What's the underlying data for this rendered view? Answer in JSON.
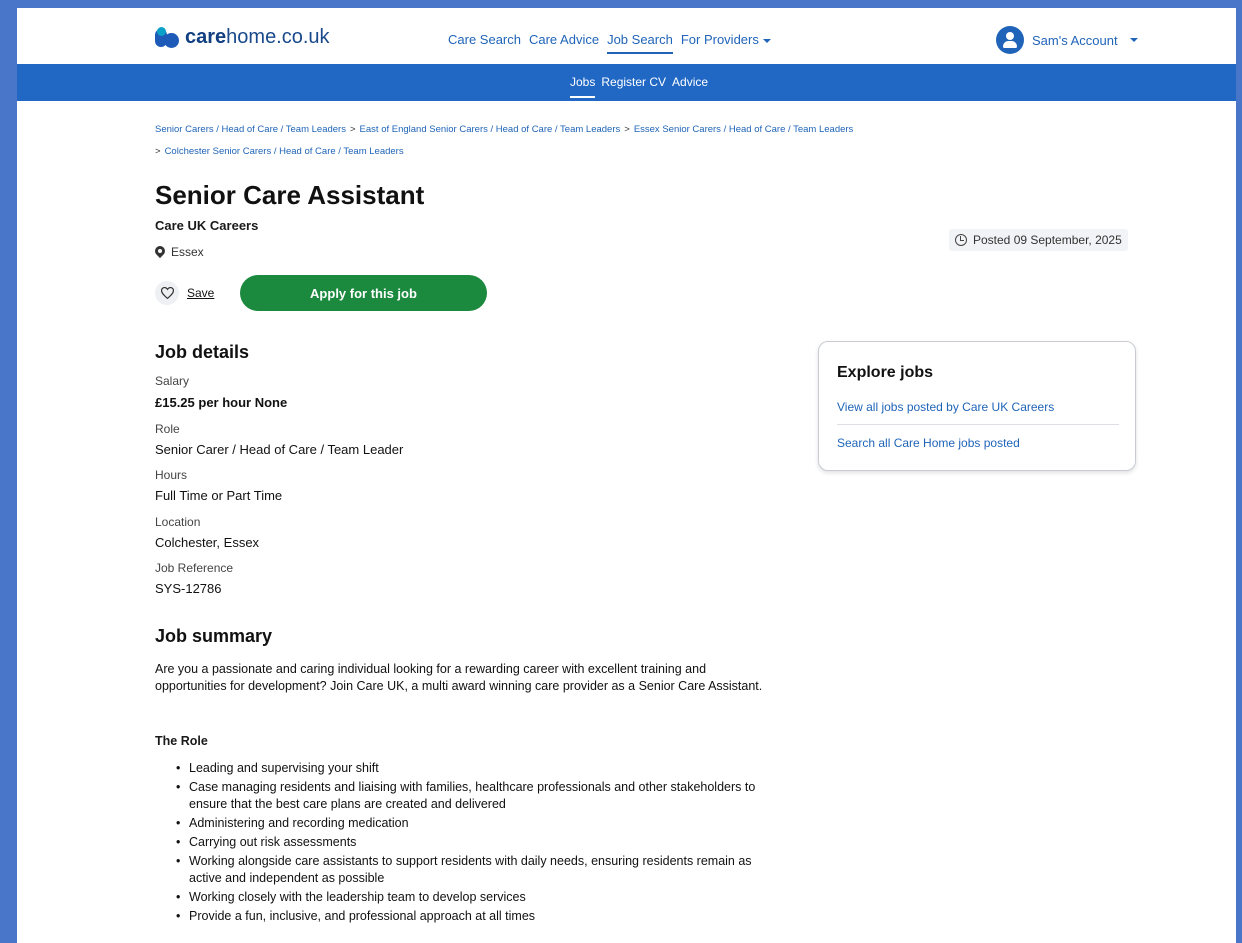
{
  "nav": {
    "logo_care": "care",
    "logo_rest": "home.co.uk",
    "links": [
      {
        "label": "Care Search"
      },
      {
        "label": "Care Advice"
      },
      {
        "label": "Job Search"
      },
      {
        "label": "For Providers"
      }
    ],
    "account_label": "Sam's Account"
  },
  "subnav": {
    "links": [
      {
        "label": "Jobs"
      },
      {
        "label": "Register CV"
      },
      {
        "label": "Advice"
      }
    ]
  },
  "breadcrumb": [
    "Senior Carers / Head of Care / Team Leaders",
    "East of England Senior Carers / Head of Care / Team Leaders",
    "Essex Senior Carers / Head of Care / Team Leaders",
    "Colchester Senior Carers / Head of Care / Team Leaders"
  ],
  "job": {
    "title": "Senior Care Assistant",
    "company": "Care UK Careers",
    "location": "Essex",
    "posted": "Posted 09 September, 2025",
    "save_label": "Save",
    "apply_label": "Apply for this job"
  },
  "details": {
    "heading": "Job details",
    "salary_label": "Salary",
    "salary": "£15.25 per hour None",
    "role_label": "Role",
    "role": "Senior Carer / Head of Care / Team Leader",
    "hours_label": "Hours",
    "hours": "Full Time or Part Time",
    "location_label": "Location",
    "location": "Colchester, Essex",
    "reference_label": "Job Reference",
    "reference": "SYS-12786"
  },
  "summary": {
    "heading": "Job summary",
    "intro": "Are you a passionate and caring individual looking for a rewarding career with excellent training and opportunities for development? Join Care UK, a multi award winning care provider as a Senior Care Assistant.",
    "role_heading": "The Role",
    "bullets": [
      "Leading and supervising your shift",
      "Case managing residents and liaising with families, healthcare professionals and other stakeholders to ensure that the best care plans are created and delivered",
      "Administering and recording medication",
      "Carrying out risk assessments",
      "Working alongside care assistants to support residents with daily needs, ensuring residents remain as active and independent as possible",
      "Working closely with the leadership team to develop services",
      "Provide a fun, inclusive, and professional approach at all times"
    ]
  },
  "explore": {
    "title": "Explore jobs",
    "link1": "View all jobs posted by Care UK Careers",
    "link2": "Search all Care Home jobs posted"
  },
  "colors": {
    "brand_blue": "#2168c4",
    "apply_green": "#1b8a3e",
    "link_blue": "#1f64b8"
  }
}
